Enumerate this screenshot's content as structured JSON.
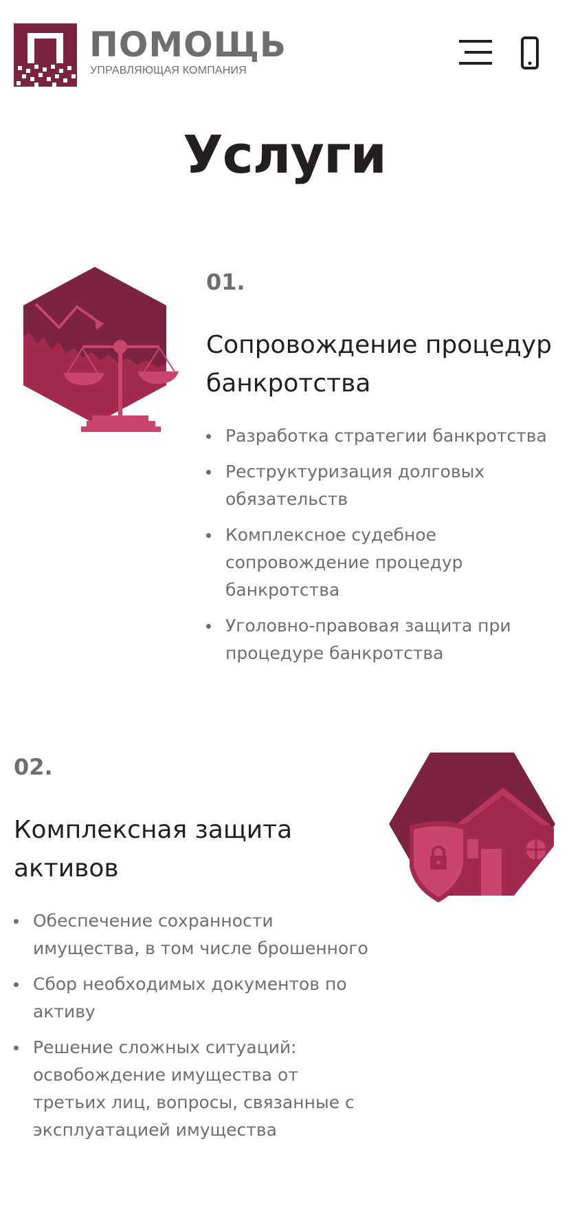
{
  "header": {
    "logo_word": "ПОМОЩЬ",
    "logo_subtitle": "УПРАВЛЯЮЩАЯ КОМПАНИЯ",
    "menu_icon": "hamburger-menu-icon",
    "phone_icon": "mobile-phone-icon"
  },
  "page_title": "Услуги",
  "colors": {
    "brand": "#7b2341",
    "brand_light": "#a3294f",
    "text_dark": "#231f20",
    "text_gray": "#6d6e70"
  },
  "services": [
    {
      "number": "01.",
      "title": "Сопровождение процедур банкротства",
      "icon": "scales-bankruptcy-icon",
      "items": [
        "Разработка стратегии банкротства",
        "Реструктуризация долговых обязательств",
        "Комплексное судебное сопровождение процедур банкротства",
        "Уголовно-правовая защита при процедуре банкротства"
      ]
    },
    {
      "number": "02.",
      "title": "Комплексная защита активов",
      "icon": "house-shield-lock-icon",
      "items": [
        "Обеспечение сохранности имущества, в том числе брошенного",
        "Сбор необходимых документов по активу",
        "Решение сложных ситуаций: освобождение имущества от третьих лиц, вопросы, связанные с эксплуатацией имущества"
      ]
    }
  ]
}
